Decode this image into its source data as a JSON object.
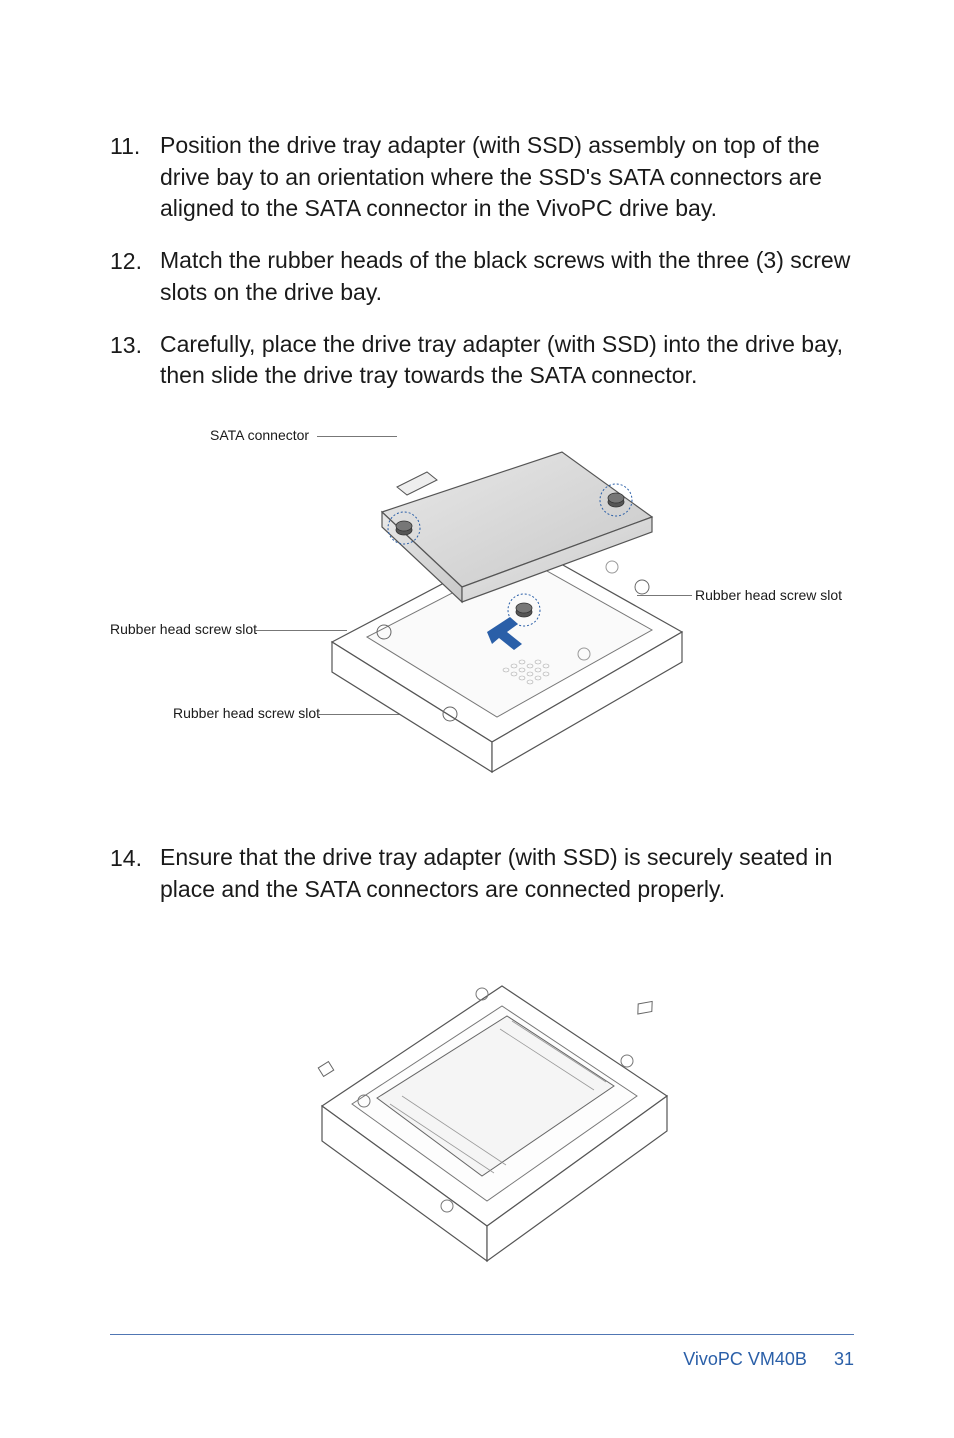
{
  "steps": [
    {
      "num": "11.",
      "text": "Position the drive tray adapter (with SSD) assembly on top of the drive bay to an orientation where the SSD's SATA connectors are aligned to the SATA connector in the VivoPC drive bay."
    },
    {
      "num": "12.",
      "text": "Match the rubber heads of the black screws with the three (3) screw slots on the drive bay."
    },
    {
      "num": "13.",
      "text": "Carefully, place the drive tray adapter (with SSD) into the drive bay, then slide the drive tray towards the SATA connector."
    },
    {
      "num": "14.",
      "text": "Ensure that the drive tray adapter (with SSD) is securely seated in place and the SATA connectors are connected properly."
    }
  ],
  "callouts": {
    "sata": "SATA connector",
    "slot_left": "Rubber head screw slot",
    "slot_bottom": "Rubber head screw slot",
    "slot_right": "Rubber head screw slot"
  },
  "footer": {
    "product": "VivoPC VM40B",
    "page": "31"
  }
}
